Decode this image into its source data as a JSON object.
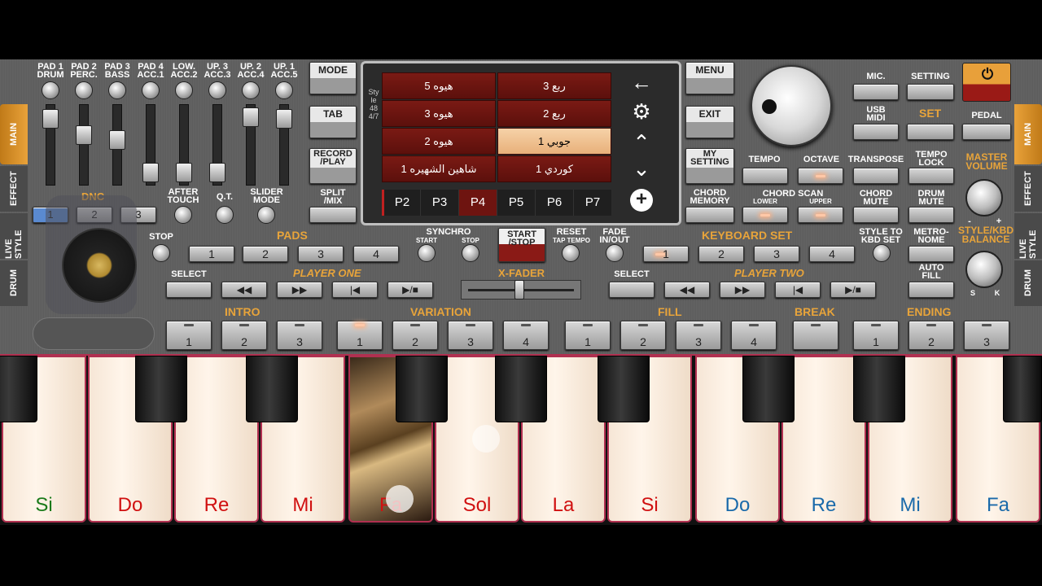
{
  "pads": {
    "labels": [
      "PAD 1\nDRUM",
      "PAD 2\nPERC.",
      "PAD 3\nBASS",
      "PAD 4\nACC.1",
      "LOW.\nACC.2",
      "UP. 3\nACC.3",
      "UP. 2\nACC.4",
      "UP. 1\nACC.5"
    ]
  },
  "left": {
    "dnc": "DNC",
    "after_touch": "AFTER\nTOUCH",
    "qt": "Q.T.",
    "slider_mode": "SLIDER\nMODE",
    "dnc_buttons": [
      "1",
      "2",
      "3"
    ],
    "stop": "STOP",
    "pads_title": "PADS",
    "pad_buttons": [
      "1",
      "2",
      "3",
      "4"
    ],
    "select": "SELECT",
    "player_one": "PLAYER ONE",
    "intro": "INTRO",
    "intro_buttons": [
      "1",
      "2",
      "3"
    ]
  },
  "mode_buttons": {
    "mode": "MODE",
    "tab": "TAB",
    "record": "RECORD\n/PLAY",
    "split": "SPLIT\n/MIX"
  },
  "screen": {
    "style_tag": "Style 48 4/7",
    "cells": [
      {
        "text": "هيوه 5",
        "sel": false
      },
      {
        "text": "ربع 3",
        "sel": false
      },
      {
        "text": "هيوه 3",
        "sel": false
      },
      {
        "text": "ربع 2",
        "sel": false
      },
      {
        "text": "هيوه 2",
        "sel": false
      },
      {
        "text": "جوبي 1",
        "sel": true
      },
      {
        "text": "شاهين الشهيره 1",
        "sel": false
      },
      {
        "text": "كوردي 1",
        "sel": false
      }
    ],
    "pages": [
      "P2",
      "P3",
      "P4",
      "P5",
      "P6",
      "P7"
    ],
    "selected_page": "P4",
    "icons": [
      "back-arrow-icon",
      "gear-icon",
      "chevron-up-icon",
      "chevron-down-icon",
      "plus-circle-icon"
    ]
  },
  "center": {
    "synchro": "SYNCHRO",
    "start": "START",
    "stop": "STOP",
    "start_stop": "START\n/STOP",
    "reset": "RESET",
    "tap_tempo": "TAP TEMPO",
    "fade": "FADE\nIN/OUT",
    "xfader": "X-FADER",
    "variation": "VARIATION",
    "variation_buttons": [
      "1",
      "2",
      "3",
      "4"
    ]
  },
  "right": {
    "menu": "MENU",
    "exit": "EXIT",
    "my_setting": "MY\nSETTING",
    "chord_memory": "CHORD\nMEMORY",
    "mic": "MIC.",
    "setting": "SETTING",
    "usb_midi": "USB\nMIDI",
    "set": "SET",
    "pedal": "PEDAL",
    "tempo": "TEMPO",
    "octave": "OCTAVE",
    "transpose": "TRANSPOSE",
    "tempo_lock": "TEMPO\nLOCK",
    "chord_scan": "CHORD SCAN",
    "lower": "LOWER",
    "upper": "UPPER",
    "chord_mute": "CHORD\nMUTE",
    "drum_mute": "DRUM\nMUTE",
    "master_volume": "MASTER\nVOLUME",
    "style_kbd_balance": "STYLE/KBD\nBALANCE",
    "s": "S",
    "k": "K",
    "minus": "-",
    "plus": "+",
    "keyboard_set": "KEYBOARD SET",
    "kbd_buttons": [
      "1",
      "2",
      "3",
      "4"
    ],
    "style_to_kbd": "STYLE TO\nKBD SET",
    "metronome": "METRO-\nNOME",
    "auto_fill": "AUTO\nFILL",
    "select": "SELECT",
    "player_two": "PLAYER TWO",
    "fill": "FILL",
    "fill_buttons": [
      "1",
      "2",
      "3",
      "4"
    ],
    "break": "BREAK",
    "ending": "ENDING",
    "ending_buttons": [
      "1",
      "2",
      "3"
    ]
  },
  "side_tabs": {
    "left": [
      "MAIN",
      "EFFECT",
      "LIVE STYLE",
      "DRUM"
    ],
    "right": [
      "MAIN",
      "EFFECT",
      "LIVE STYLE",
      "DRUM"
    ]
  },
  "keys": [
    {
      "note": "Si",
      "color": "#1a7a1a"
    },
    {
      "note": "Do",
      "color": "#d01010"
    },
    {
      "note": "Re",
      "color": "#d01010"
    },
    {
      "note": "Mi",
      "color": "#d01010"
    },
    {
      "note": "Fa",
      "color": "#d01010"
    },
    {
      "note": "Sol",
      "color": "#d01010"
    },
    {
      "note": "La",
      "color": "#d01010"
    },
    {
      "note": "Si",
      "color": "#d01010"
    },
    {
      "note": "Do",
      "color": "#1a6aaa"
    },
    {
      "note": "Re",
      "color": "#1a6aaa"
    },
    {
      "note": "Mi",
      "color": "#1a6aaa"
    },
    {
      "note": "Fa",
      "color": "#1a6aaa"
    }
  ]
}
